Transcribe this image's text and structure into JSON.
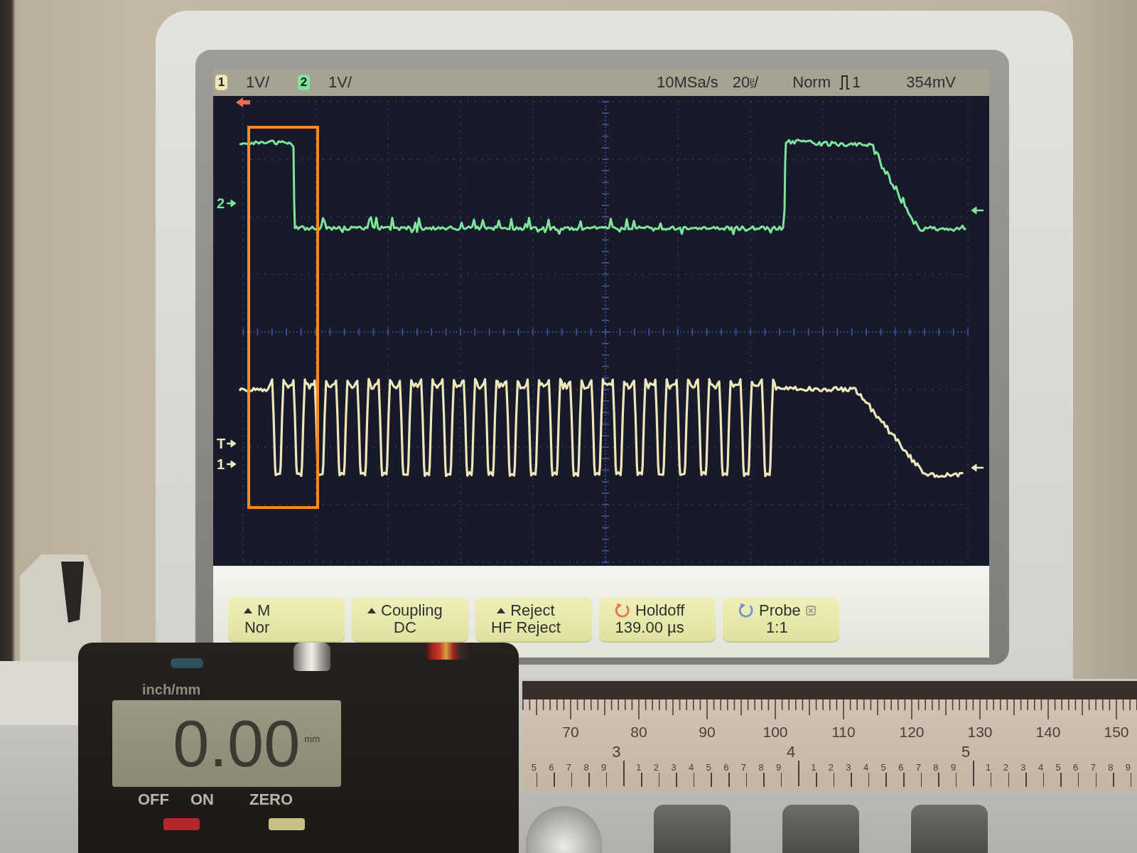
{
  "status_bar": {
    "channels": [
      {
        "number": "1",
        "scale": "1V/",
        "color": "#efe7b8"
      },
      {
        "number": "2",
        "scale": "1V/",
        "color": "#7fe39a"
      }
    ],
    "sample_rate": "10MSa/s",
    "timebase": "20$^{µ}$$_{s}$/",
    "trigger": {
      "mode": "Norm",
      "source": "1",
      "level": "354mV"
    }
  },
  "screen": {
    "markers": [
      {
        "label": "2",
        "color": "#7fe39a"
      },
      {
        "label": "T",
        "color": "#efe7b8"
      },
      {
        "label": "1",
        "color": "#efe7b8"
      }
    ]
  },
  "softkeys": [
    {
      "kind": "menu",
      "title": "M",
      "value": "Nor",
      "x_mark": false
    },
    {
      "kind": "menu",
      "title": "Coupling",
      "value": "DC",
      "x_mark": false
    },
    {
      "kind": "menu",
      "title": "Reject",
      "value": "HF Reject",
      "x_mark": false
    },
    {
      "kind": "knob",
      "title": "Holdoff",
      "value": "139.00 µs",
      "color": "#e8734a",
      "x_mark": false
    },
    {
      "kind": "knob",
      "title": "Probe",
      "value": "1:1",
      "color": "#6f8fd8",
      "x_mark": true
    }
  ],
  "caliper": {
    "unit_label": "inch/mm",
    "reading": "0.00",
    "reading_unit": "mm",
    "labels": [
      "OFF",
      "ON",
      "ZERO"
    ],
    "ruler": {
      "mm_labels": [
        "70",
        "80",
        "90",
        "100",
        "110",
        "120",
        "130",
        "140",
        "150"
      ],
      "inch_lead": [
        "5",
        "6",
        "7",
        "8",
        "9"
      ],
      "inches": [
        {
          "number": "3",
          "tenths": [
            "1",
            "2",
            "3",
            "4",
            "5",
            "6",
            "7",
            "8",
            "9"
          ]
        },
        {
          "number": "4",
          "tenths": [
            "1",
            "2",
            "3",
            "4",
            "5",
            "6",
            "7",
            "8",
            "9"
          ]
        },
        {
          "number": "5",
          "tenths": [
            "1",
            "2",
            "3",
            "4",
            "5",
            "6",
            "7",
            "8",
            "9"
          ]
        }
      ]
    }
  }
}
